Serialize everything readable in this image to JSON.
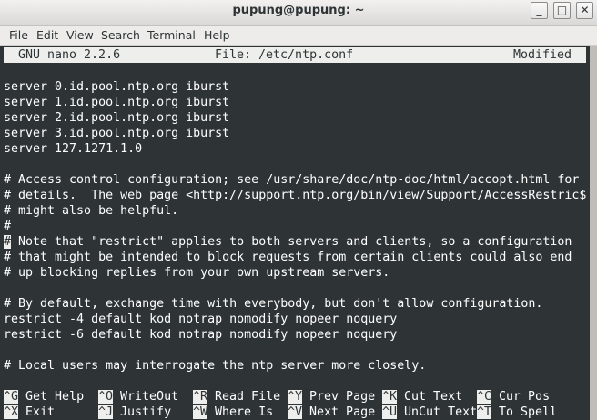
{
  "window": {
    "title": "pupung@pupung: ~"
  },
  "window_buttons": [
    "_",
    "□",
    "✕"
  ],
  "menu": [
    "File",
    "Edit",
    "View",
    "Search",
    "Terminal",
    "Help"
  ],
  "nano": {
    "version": "GNU nano 2.2.6",
    "file": "File: /etc/ntp.conf",
    "status": "Modified"
  },
  "lines": [
    "",
    "server 0.id.pool.ntp.org iburst",
    "server 1.id.pool.ntp.org iburst",
    "server 2.id.pool.ntp.org iburst",
    "server 3.id.pool.ntp.org iburst",
    "server 127.1271.1.0",
    "",
    "# Access control configuration; see /usr/share/doc/ntp-doc/html/accopt.html for",
    "# details.  The web page <http://support.ntp.org/bin/view/Support/AccessRestric$",
    "# might also be helpful.",
    "#",
    " Note that \"restrict\" applies to both servers and clients, so a configuration",
    "# that might be intended to block requests from certain clients could also end",
    "# up blocking replies from your own upstream servers.",
    "",
    "# By default, exchange time with everybody, but don't allow configuration.",
    "restrict -4 default kod notrap nomodify nopeer noquery",
    "restrict -6 default kod notrap nomodify nopeer noquery",
    "",
    "# Local users may interrogate the ntp server more closely."
  ],
  "cursor_char": "#",
  "shortcuts": [
    {
      "key": "^G",
      "label": "Get Help"
    },
    {
      "key": "^O",
      "label": "WriteOut"
    },
    {
      "key": "^R",
      "label": "Read File"
    },
    {
      "key": "^Y",
      "label": "Prev Page"
    },
    {
      "key": "^K",
      "label": "Cut Text"
    },
    {
      "key": "^C",
      "label": "Cur Pos"
    },
    {
      "key": "^X",
      "label": "Exit"
    },
    {
      "key": "^J",
      "label": "Justify"
    },
    {
      "key": "^W",
      "label": "Where Is"
    },
    {
      "key": "^V",
      "label": "Next Page"
    },
    {
      "key": "^U",
      "label": "UnCut Text"
    },
    {
      "key": "^T",
      "label": "To Spell"
    }
  ]
}
